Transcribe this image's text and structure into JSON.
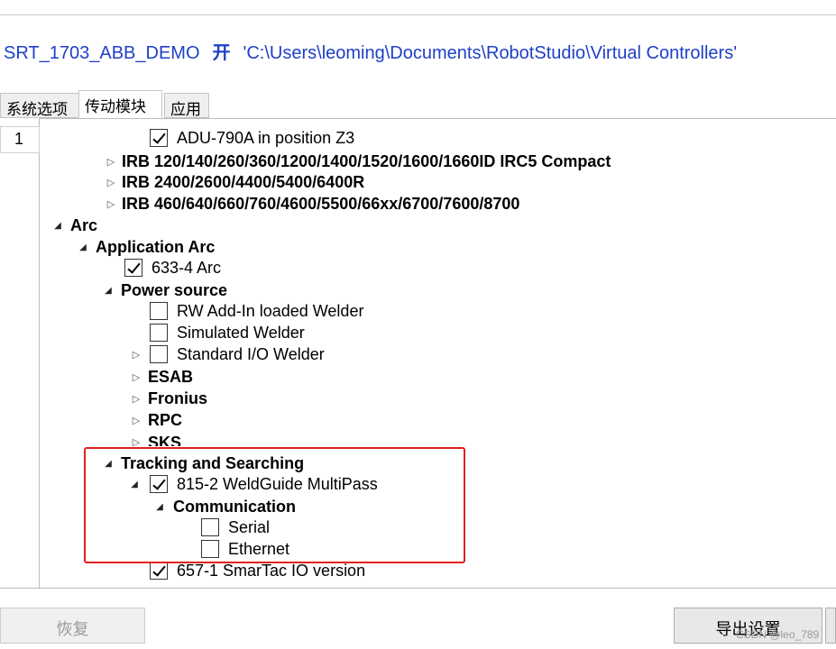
{
  "header": {
    "controller": "SRT_1703_ABB_DEMO",
    "status": "开",
    "path": "'C:\\Users\\leoming\\Documents\\RobotStudio\\Virtual Controllers'"
  },
  "tabs": [
    {
      "label": "系统选项",
      "active": false
    },
    {
      "label": "传动模块",
      "active": true
    },
    {
      "label": "应用",
      "active": false
    }
  ],
  "row_number": "1",
  "tree": [
    {
      "label": "ADU-790A in position Z3",
      "checkbox": true,
      "checked": true,
      "bold": false
    },
    {
      "label": "IRB 120/140/260/360/1200/1400/1520/1600/1660ID IRC5 Compact",
      "bold": true,
      "expander": "collapsed"
    },
    {
      "label": "IRB 2400/2600/4400/5400/6400R",
      "bold": true,
      "expander": "collapsed"
    },
    {
      "label": "IRB 460/640/660/760/4600/5500/66xx/6700/7600/8700",
      "bold": true,
      "expander": "collapsed"
    },
    {
      "label": "Arc",
      "bold": true,
      "expander": "expanded"
    },
    {
      "label": "Application Arc",
      "bold": true,
      "expander": "expanded"
    },
    {
      "label": "633-4 Arc",
      "checkbox": true,
      "checked": true
    },
    {
      "label": "Power source",
      "bold": true,
      "expander": "expanded"
    },
    {
      "label": "RW Add-In loaded Welder",
      "checkbox": true,
      "checked": false
    },
    {
      "label": "Simulated Welder",
      "checkbox": true,
      "checked": false
    },
    {
      "label": "Standard I/O Welder",
      "checkbox": true,
      "checked": false,
      "expander": "collapsed"
    },
    {
      "label": "ESAB",
      "bold": true,
      "expander": "collapsed"
    },
    {
      "label": "Fronius",
      "bold": true,
      "expander": "collapsed"
    },
    {
      "label": "RPC",
      "bold": true,
      "expander": "collapsed"
    },
    {
      "label": "SKS",
      "bold": true,
      "expander": "collapsed"
    },
    {
      "label": "Tracking and Searching",
      "bold": true,
      "expander": "expanded"
    },
    {
      "label": "815-2 WeldGuide MultiPass",
      "checkbox": true,
      "checked": true,
      "expander": "expanded"
    },
    {
      "label": "Communication",
      "bold": true,
      "expander": "expanded"
    },
    {
      "label": "Serial",
      "checkbox": true,
      "checked": false
    },
    {
      "label": "Ethernet",
      "checkbox": true,
      "checked": false
    },
    {
      "label": "657-1 SmarTac IO version",
      "checkbox": true,
      "checked": true
    }
  ],
  "buttons": {
    "restore": "恢复",
    "export": "导出设置"
  },
  "watermark": "CSDN @leo_789",
  "colors": {
    "title": "#1e3fc8",
    "highlight": "#e02020"
  }
}
